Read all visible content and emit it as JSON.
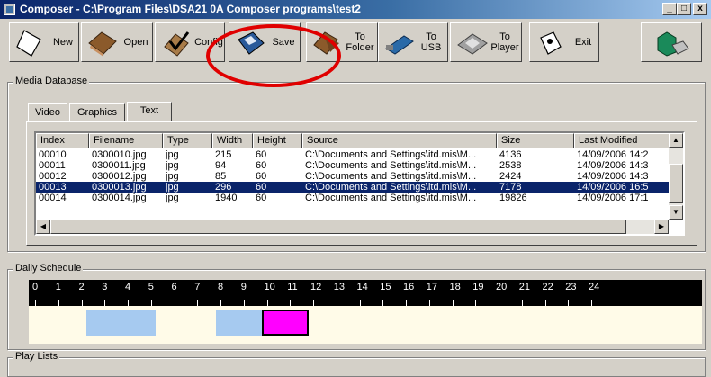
{
  "window": {
    "title": "Composer - C:\\Program Files\\DSA21 0A Composer programs\\test2",
    "minimize": "_",
    "maximize": "□",
    "close": "x"
  },
  "toolbar": {
    "new": "New",
    "open": "Open",
    "config": "Config",
    "save": "Save",
    "to_folder_1": "To",
    "to_folder_2": "Folder",
    "to_usb_1": "To",
    "to_usb_2": "USB",
    "to_player_1": "To",
    "to_player_2": "Player",
    "exit": "Exit"
  },
  "media_db": {
    "title": "Media Database",
    "tabs": [
      "Video",
      "Graphics",
      "Text"
    ],
    "columns": [
      "Index",
      "Filename",
      "Type",
      "Width",
      "Height",
      "Source",
      "Size",
      "Last Modified"
    ],
    "rows": [
      [
        "00010",
        "0300010.jpg",
        "jpg",
        "215",
        "60",
        "C:\\Documents and Settings\\itd.mis\\M...",
        "4136",
        "14/09/2006 14:2"
      ],
      [
        "00011",
        "0300011.jpg",
        "jpg",
        "94",
        "60",
        "C:\\Documents and Settings\\itd.mis\\M...",
        "2538",
        "14/09/2006 14:3"
      ],
      [
        "00012",
        "0300012.jpg",
        "jpg",
        "85",
        "60",
        "C:\\Documents and Settings\\itd.mis\\M...",
        "2424",
        "14/09/2006 14:3"
      ],
      [
        "00013",
        "0300013.jpg",
        "jpg",
        "296",
        "60",
        "C:\\Documents and Settings\\itd.mis\\M...",
        "7178",
        "14/09/2006 16:5"
      ],
      [
        "00014",
        "0300014.jpg",
        "jpg",
        "1940",
        "60",
        "C:\\Documents and Settings\\itd.mis\\M...",
        "19826",
        "14/09/2006 17:1"
      ]
    ],
    "selected_row": 3
  },
  "schedule": {
    "title": "Daily Schedule",
    "hours": [
      "0",
      "1",
      "2",
      "3",
      "4",
      "5",
      "6",
      "7",
      "8",
      "9",
      "10",
      "11",
      "12",
      "13",
      "14",
      "15",
      "16",
      "17",
      "18",
      "19",
      "20",
      "21",
      "22",
      "23",
      "24"
    ],
    "blocks": [
      {
        "start_hour": 2.2,
        "end_hour": 5.2,
        "color": "#a6caf0"
      },
      {
        "start_hour": 7.8,
        "end_hour": 9.8,
        "color": "#a6caf0"
      },
      {
        "start_hour": 9.8,
        "end_hour": 11.8,
        "color": "#ff00ff"
      }
    ]
  },
  "playlists": {
    "title": "Play Lists"
  },
  "colors": {
    "title_bar": "#0a246a",
    "selection": "#0a246a",
    "annotation": "#e00000"
  }
}
